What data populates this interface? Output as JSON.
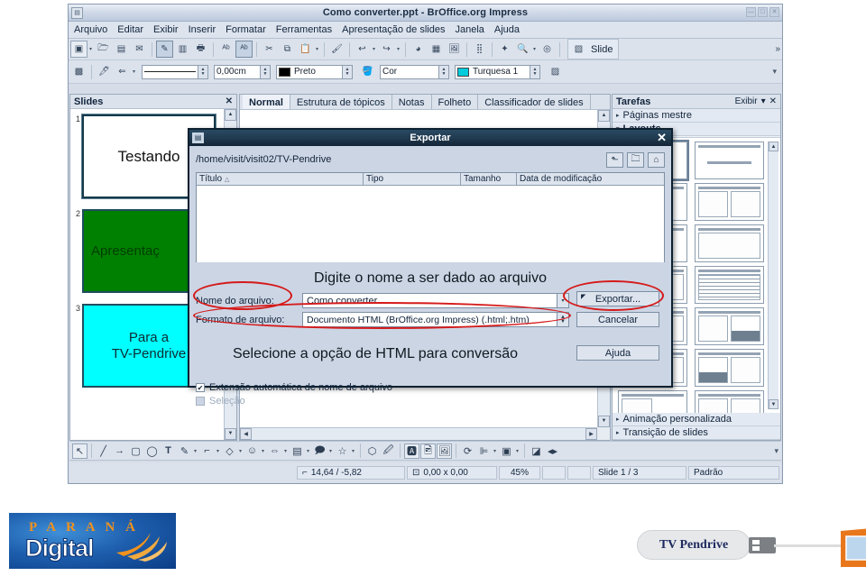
{
  "window": {
    "title": "Como converter.ppt - BrOffice.org Impress",
    "icon": "document-icon",
    "buttons": [
      {
        "name": "minimize-button",
        "glyph": "—"
      },
      {
        "name": "maximize-button",
        "glyph": "□"
      },
      {
        "name": "close-button",
        "glyph": "✕"
      }
    ]
  },
  "menubar": {
    "items": [
      {
        "label": "Arquivo",
        "accel": "A"
      },
      {
        "label": "Editar",
        "accel": "E"
      },
      {
        "label": "Exibir",
        "accel": "x"
      },
      {
        "label": "Inserir",
        "accel": "I"
      },
      {
        "label": "Formatar",
        "accel": "o"
      },
      {
        "label": "Ferramentas",
        "accel": "ç"
      },
      {
        "label": "Apresentação de slides",
        "accel": "s"
      },
      {
        "label": "Janela",
        "accel": "J"
      },
      {
        "label": "Ajuda",
        "accel": "u"
      }
    ]
  },
  "toolbar_main": {
    "buttons": [
      "new-document-icon",
      "open-icon",
      "save-icon",
      "email-icon",
      "edit-file-icon",
      "export-pdf-icon",
      "print-icon",
      "print-preview-icon",
      "spellcheck-icon",
      "autospellcheck-icon",
      "cut-icon",
      "copy-icon",
      "paste-icon",
      "clone-formatting-icon",
      "undo-icon",
      "redo-icon",
      "chart-icon",
      "table-icon",
      "image-icon",
      "grid-icon",
      "effects-icon",
      "zoom-icon",
      "help-icon"
    ],
    "slide_button_label": "Slide",
    "overflow_glyph": "»"
  },
  "toolbar_line_fill": {
    "line_style_value": "",
    "line_width_value": "0,00cm",
    "line_color_value": "Preto",
    "fill_style_value": "Cor",
    "fill_color_value": "Turquesa 1",
    "line_color_swatch": "#000000",
    "fill_color_swatch": "#00ccdd"
  },
  "slides_panel": {
    "title": "Slides",
    "close_glyph": "✕",
    "slides": [
      {
        "number": "1",
        "text": "Testando",
        "bg": "#ffffff",
        "color": "#111111",
        "selected": true
      },
      {
        "number": "2",
        "text": "Apresentaç",
        "bg": "#008000",
        "color": "#003300",
        "selected": false
      },
      {
        "number": "3",
        "text": "Para a\nTV-Pendrive",
        "bg": "#00ffff",
        "color": "#102a33",
        "selected": false
      }
    ]
  },
  "view_tabs": {
    "tabs": [
      {
        "label": "Normal",
        "active": true
      },
      {
        "label": "Estrutura de tópicos",
        "active": false
      },
      {
        "label": "Notas",
        "active": false
      },
      {
        "label": "Folheto",
        "active": false
      },
      {
        "label": "Classificador de slides",
        "active": false
      }
    ]
  },
  "tasks_panel": {
    "title": "Tarefas",
    "view_label": "Exibir",
    "dropdown_glyph": "▾",
    "close_glyph": "✕",
    "sections": [
      {
        "label": "Páginas mestre",
        "open": false,
        "tri": "▸"
      },
      {
        "label": "Layouts",
        "open": true,
        "tri": "▾"
      },
      {
        "label": "Animação personalizada",
        "open": false,
        "tri": "▸"
      },
      {
        "label": "Transição de slides",
        "open": false,
        "tri": "▸"
      }
    ],
    "layouts": [
      {
        "name": "blank-layout",
        "selected": true,
        "kind": "blank"
      },
      {
        "name": "title-content-layout",
        "selected": false,
        "kind": "title-sub"
      },
      {
        "name": "title-only-layout",
        "selected": false,
        "kind": "bar-only"
      },
      {
        "name": "two-content-layout",
        "selected": false,
        "kind": "two-list"
      },
      {
        "name": "title-content-box-layout",
        "selected": false,
        "kind": "one-box"
      },
      {
        "name": "title-content-empty-layout",
        "selected": false,
        "kind": "bar-empty"
      },
      {
        "name": "table-layout",
        "selected": false,
        "kind": "table"
      },
      {
        "name": "list-chart-layout",
        "selected": false,
        "kind": "list-chart"
      },
      {
        "name": "chart-list-layout",
        "selected": false,
        "kind": "chart-list"
      },
      {
        "name": "list-box-layout",
        "selected": false,
        "kind": "list-box"
      },
      {
        "name": "list-two-box-layout",
        "selected": false,
        "kind": "list-twobox"
      },
      {
        "name": "list-blank-layout",
        "selected": false,
        "kind": "list-blank"
      }
    ]
  },
  "draw_toolbar": {
    "buttons": [
      "select-icon",
      "line-icon",
      "arrow-icon",
      "rectangle-icon",
      "ellipse-icon",
      "text-icon",
      "curve-icon",
      "connector-icon",
      "basic-shapes-icon",
      "symbol-shapes-icon",
      "block-arrows-icon",
      "flowchart-icon",
      "callout-icon",
      "stars-icon",
      "points-icon",
      "glue-points-icon",
      "fontwork-icon",
      "from-file-icon",
      "gallery-icon",
      "rotate-icon",
      "alignment-icon",
      "arrange-icon",
      "shadow-icon",
      "crop-icon"
    ]
  },
  "statusbar": {
    "position_icon": "position-icon",
    "position": "14,64 / -5,82",
    "size_icon": "size-icon",
    "size": "0,00 x 0,00",
    "zoom": "45%",
    "slide_info": "Slide 1 / 3",
    "master": "Padrão"
  },
  "dialog": {
    "title": "Exportar",
    "title_icon": "export-dialog-icon",
    "close_glyph": "✕",
    "path": "/home/visit/visit02/TV-Pendrive",
    "path_buttons": [
      {
        "name": "up-one-level-button",
        "glyph": "⬑"
      },
      {
        "name": "create-folder-button",
        "glyph": "🗀"
      },
      {
        "name": "default-directory-button",
        "glyph": "⌂"
      }
    ],
    "columns": [
      {
        "label": "Título",
        "sort_glyph": "△"
      },
      {
        "label": "Tipo",
        "sort_glyph": ""
      },
      {
        "label": "Tamanho",
        "sort_glyph": ""
      },
      {
        "label": "Data de modificação",
        "sort_glyph": ""
      }
    ],
    "file_rows": [],
    "filename_label": "Nome do arquivo:",
    "filename_value": "Como converter",
    "filename_dropdown_glyph": "▾",
    "filetype_label": "Formato de arquivo:",
    "filetype_value": "Documento HTML (BrOffice.org Impress) (.html;.htm)",
    "buttons": [
      {
        "name": "export-button",
        "label": "Exportar...",
        "default": true
      },
      {
        "name": "cancel-button",
        "label": "Cancelar",
        "default": false
      },
      {
        "name": "help-button",
        "label": "Ajuda",
        "default": false
      }
    ],
    "checkboxes": [
      {
        "name": "auto-extension-checkbox",
        "label": "Extensão automática de nome de arquivo",
        "checked": true,
        "enabled": true,
        "glyph": "✔"
      },
      {
        "name": "selection-checkbox",
        "label": "Seleção",
        "checked": false,
        "enabled": false,
        "glyph": ""
      }
    ]
  },
  "annotations": {
    "note_filename": "Digite o nome a ser dado ao arquivo",
    "note_format": "Selecione a opção de HTML para conversão",
    "highlight_color": "#d51a1a"
  },
  "branding": {
    "parana_top": "P A R A N Á",
    "parana_bottom": "Digital",
    "tv_pendrive": "TV Pendrive"
  }
}
